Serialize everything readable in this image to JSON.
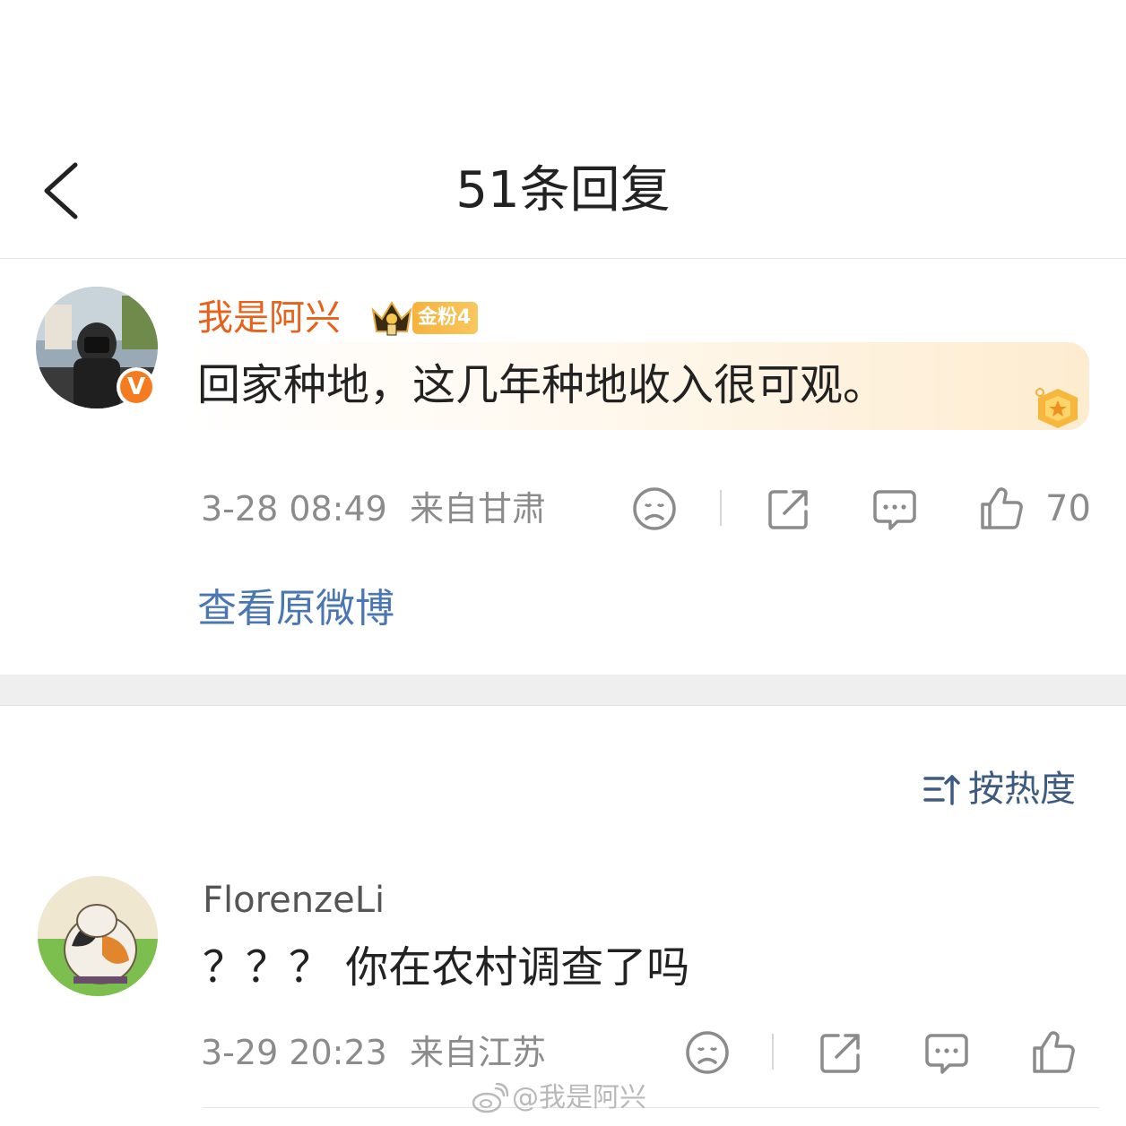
{
  "header": {
    "title": "51条回复"
  },
  "main_comment": {
    "username": "我是阿兴",
    "fan_badge": "金粉4",
    "text": "回家种地，这几年种地收入很可观。",
    "time": "3-28 08:49",
    "location": "来自甘肃",
    "like_count": "70"
  },
  "view_original": "查看原微博",
  "sort": {
    "label": "按热度"
  },
  "reply": {
    "username": "FlorenzeLi",
    "text": "？？？ 你在农村调查了吗",
    "time": "3-29 20:23",
    "location": "来自江苏"
  },
  "watermark": "@我是阿兴",
  "colors": {
    "username_orange": "#e8611a",
    "link_blue": "#4a77b3",
    "meta_gray": "#8b8b8b",
    "badge_gold": "#f6b23d",
    "verified_orange": "#f47b20"
  }
}
